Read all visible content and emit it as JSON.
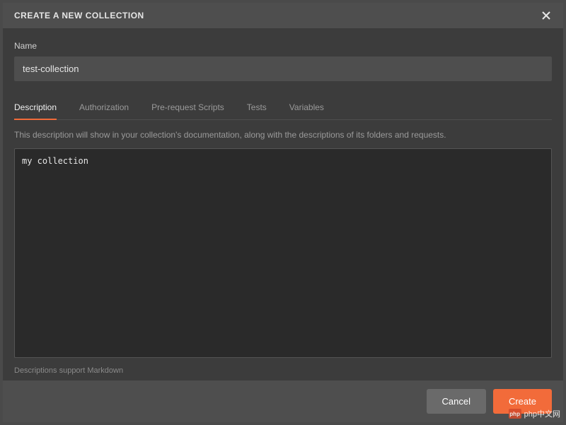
{
  "modal": {
    "title": "CREATE A NEW COLLECTION",
    "name_label": "Name",
    "name_value": "test-collection",
    "description_help": "This description will show in your collection's documentation, along with the descriptions of its folders and requests.",
    "description_value": "my collection",
    "markdown_hint": "Descriptions support Markdown",
    "cancel_label": "Cancel",
    "create_label": "Create"
  },
  "tabs": {
    "items": [
      {
        "label": "Description",
        "active": true
      },
      {
        "label": "Authorization",
        "active": false
      },
      {
        "label": "Pre-request Scripts",
        "active": false
      },
      {
        "label": "Tests",
        "active": false
      },
      {
        "label": "Variables",
        "active": false
      }
    ]
  },
  "watermark": {
    "logo_text": "php",
    "text": "php中文网"
  },
  "colors": {
    "accent": "#f26b3a",
    "panel": "#3c3c3c",
    "header": "#4e4e4e",
    "input_bg": "#2a2a2a"
  }
}
